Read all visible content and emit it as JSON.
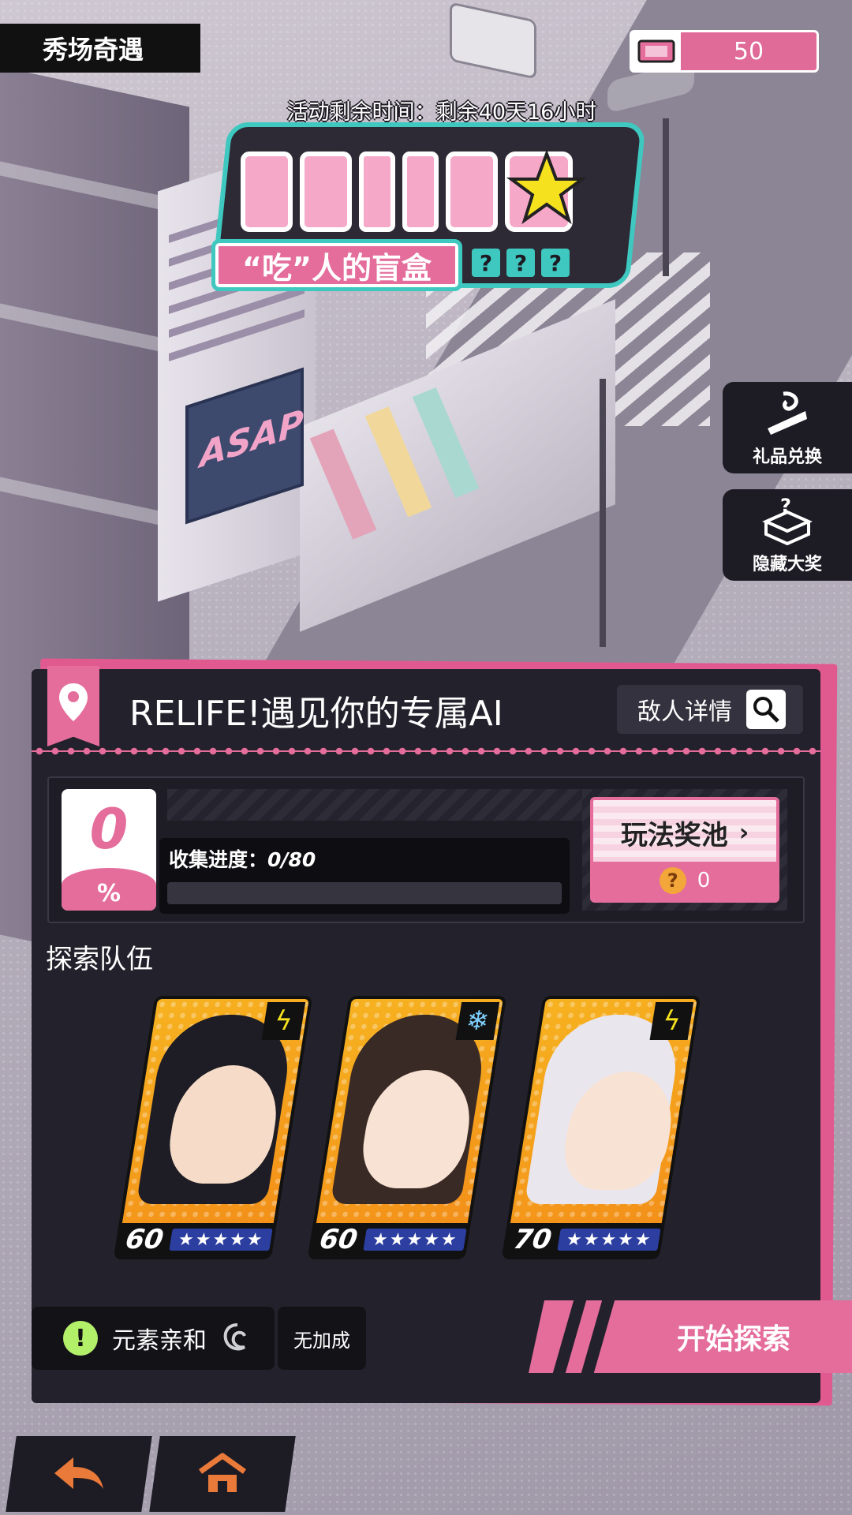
{
  "header": {
    "page_tab": "秀场奇遇",
    "ticket_count": "50",
    "ticket_icon": "ticket-icon",
    "timer": "活动剩余时间：剩余40天16小时"
  },
  "logo": {
    "subtitle": "“吃”人的盲盒",
    "marks": [
      "?",
      "?",
      "?"
    ]
  },
  "side": {
    "gift_label": "礼品兑换",
    "hidden_label": "隐藏大奖"
  },
  "panel": {
    "stage_title": "RELIFE!遇见你的专属AI",
    "enemy_details": "敌人详情",
    "percent_value": "0",
    "percent_symbol": "%",
    "progress_label": "收集进度：",
    "progress_value": "0/80",
    "progress_fraction": 0,
    "pool_label": "玩法奖池",
    "pool_coins": "0",
    "team_title": "探索队伍",
    "team": [
      {
        "level": "60",
        "stars": "★★★★★",
        "element": "lightning-icon"
      },
      {
        "level": "60",
        "stars": "★★★★★",
        "element": "ice-icon"
      },
      {
        "level": "70",
        "stars": "★★★★★",
        "element": "lightning-icon"
      }
    ],
    "affinity_label": "元素亲和",
    "bonus_label": "无加成",
    "start_label": "开始探索"
  },
  "colors": {
    "accent_pink": "#e46d9c",
    "panel_bg": "#23212b",
    "teal": "#3ec8c0",
    "card_orange": "#f39019"
  },
  "nav": {
    "back_icon": "back-arrow-icon",
    "home_icon": "home-icon"
  }
}
